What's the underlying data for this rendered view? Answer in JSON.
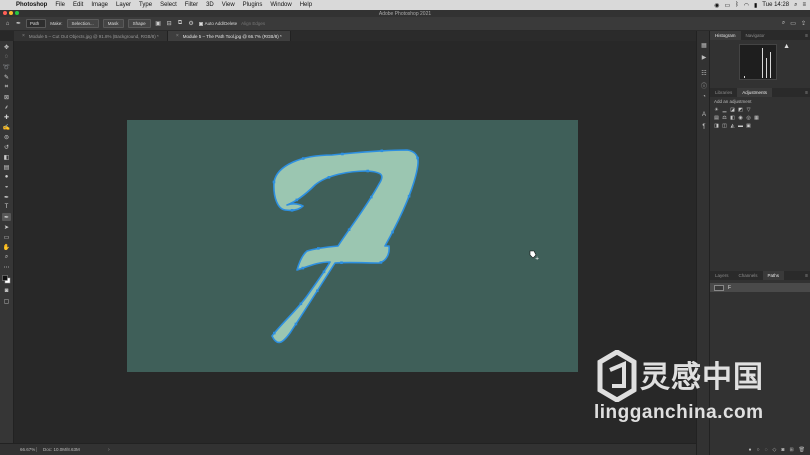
{
  "mac_menu": {
    "apple": "",
    "items": [
      "Photoshop",
      "File",
      "Edit",
      "Image",
      "Layer",
      "Type",
      "Select",
      "Filter",
      "3D",
      "View",
      "Plugins",
      "Window",
      "Help"
    ],
    "clock": "Tue 14:28"
  },
  "window": {
    "title": "Adobe Photoshop 2021"
  },
  "options": {
    "mode": "Path",
    "make_label": "Make:",
    "selection_label": "Selection...",
    "mask_label": "Mask",
    "shape_label": "Shape",
    "auto_add_delete": "Auto Add/Delete",
    "align_edges": "Align Edges"
  },
  "tabs": [
    {
      "label": "Module 5 – Cut Out Objects.jpg @ 91.8% (Background, RGB/8) *",
      "active": false
    },
    {
      "label": "Module 5 – The Path Tool.jpg @ 66.7% (RGB/8) *",
      "active": true
    }
  ],
  "canvas": {
    "background": "#3f5f59",
    "letter_fill": "#9bc6b1",
    "path_color": "#2d8fe0"
  },
  "status": {
    "zoom": "66.67%",
    "doc": "Doc: 10.0M/8.63M"
  },
  "panels": {
    "top_tabs": [
      "Histogram",
      "Navigator"
    ],
    "mid_tabs": [
      "Libraries",
      "Adjustments"
    ],
    "add_adjustment": "Add an adjustment",
    "bottom_tabs": [
      "Layers",
      "Channels",
      "Paths"
    ],
    "path_name": "F"
  },
  "watermark": {
    "cn": "灵感中国",
    "en": "lingganchina.com"
  }
}
